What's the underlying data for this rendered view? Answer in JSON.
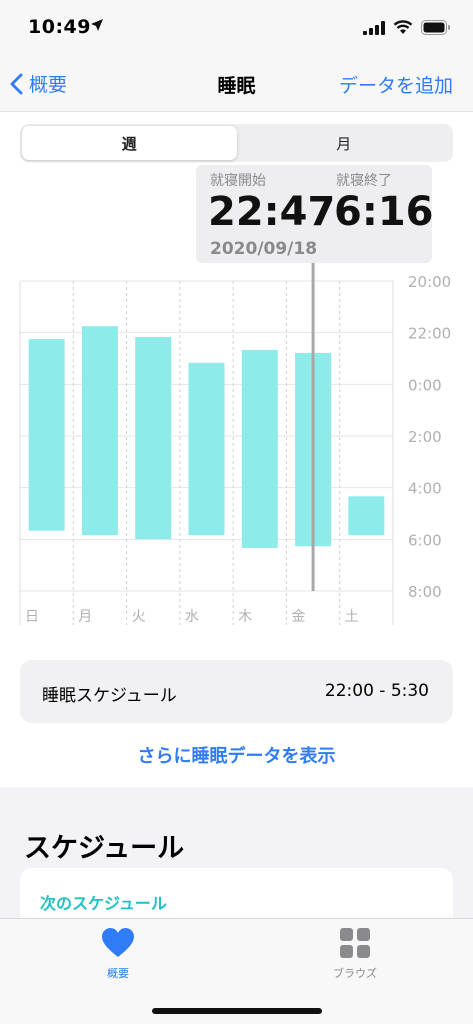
{
  "status_bar": {
    "time": "10:49"
  },
  "nav": {
    "back_label": "概要",
    "title": "睡眠",
    "add_label": "データを追加"
  },
  "segments": {
    "week": "週",
    "month": "月"
  },
  "tooltip": {
    "start_label": "就寝開始",
    "start_value": "22:47",
    "end_label": "就寝終了",
    "end_value": "6:16",
    "date": "2020/09/18"
  },
  "chart_data": {
    "type": "bar",
    "subtype": "floating-range",
    "categories": [
      "日",
      "月",
      "火",
      "水",
      "木",
      "金",
      "土"
    ],
    "y_ticks": [
      "20:00",
      "22:00",
      "0:00",
      "2:00",
      "4:00",
      "6:00",
      "8:00"
    ],
    "y_axis_range_hours_since_20": [
      0,
      12
    ],
    "series": [
      {
        "values": [
          {
            "start": "22:15",
            "end": "5:40"
          },
          {
            "start": "21:45",
            "end": "5:50"
          },
          {
            "start": "22:10",
            "end": "6:00"
          },
          {
            "start": "23:10",
            "end": "5:50"
          },
          {
            "start": "22:40",
            "end": "6:20"
          },
          {
            "start": "22:47",
            "end": "6:16"
          },
          {
            "start": "4:20",
            "end": "5:50"
          }
        ]
      }
    ],
    "selected_category": "金",
    "bar_color": "#8decea",
    "grid": true,
    "y_axis_position": "right"
  },
  "schedule": {
    "label": "睡眠スケジュール",
    "time": "22:00 - 5:30"
  },
  "more_link": "さらに睡眠データを表示",
  "schedule_section": {
    "title": "スケジュール",
    "next_label": "次のスケジュール"
  },
  "tabs": {
    "summary": "概要",
    "browse": "ブラウズ"
  },
  "colors": {
    "accent": "#2f7cf6",
    "teal": "#21c0c2",
    "bar": "#8decea"
  }
}
